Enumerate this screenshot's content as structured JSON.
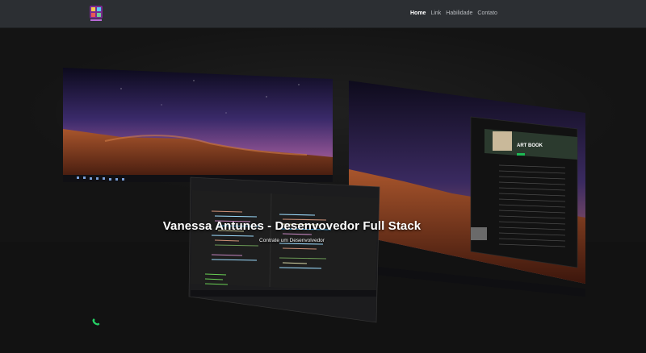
{
  "navbar": {
    "links": [
      {
        "label": "Home",
        "active": true
      },
      {
        "label": "Link",
        "active": false
      },
      {
        "label": "Habilidade",
        "active": false
      },
      {
        "label": "Contato",
        "active": false
      }
    ]
  },
  "hero": {
    "title": "Vanessa Antunes - Desenvovedor Full Stack",
    "subtitle": "Contrate um Desenvolvedor"
  },
  "colors": {
    "navbar_bg": "#2c2f33",
    "page_bg": "#141414",
    "whatsapp_green": "#25d366"
  },
  "icons": {
    "logo": "logo-icon",
    "whatsapp": "whatsapp-icon"
  }
}
